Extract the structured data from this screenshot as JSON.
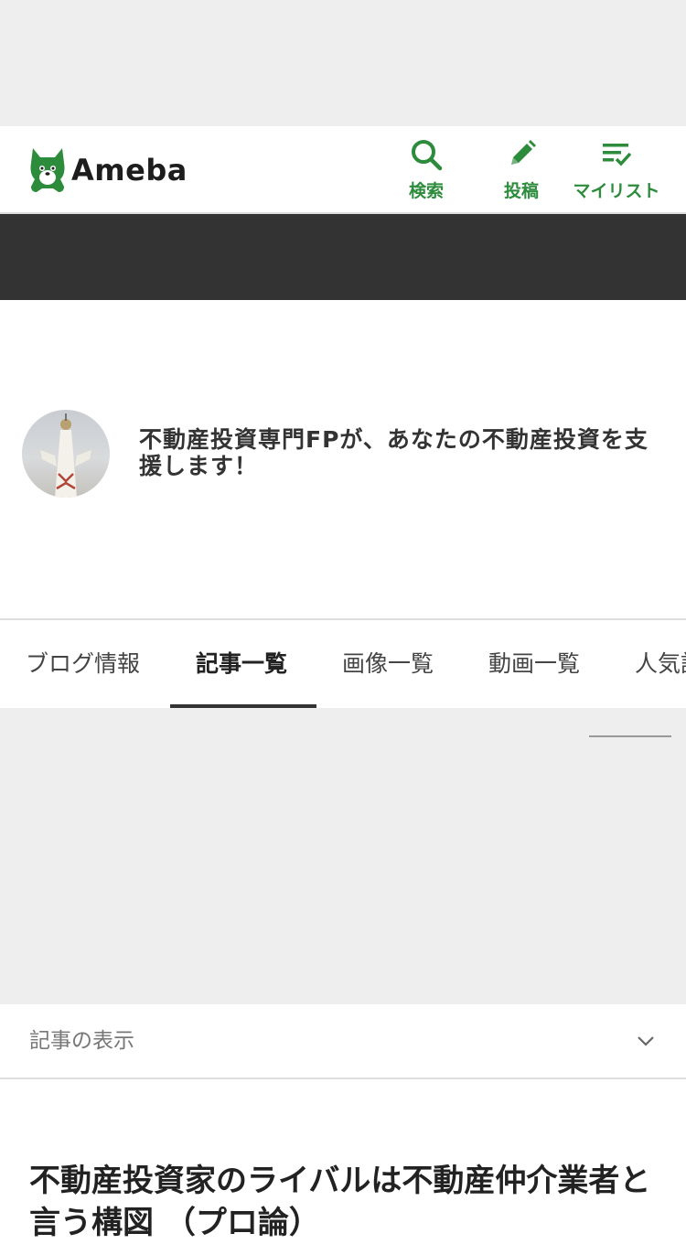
{
  "header": {
    "logo_text": "Ameba",
    "buttons": [
      {
        "label": "検索",
        "icon": "search-icon"
      },
      {
        "label": "投稿",
        "icon": "pencil-icon"
      },
      {
        "label": "マイリスト",
        "icon": "mylist-icon"
      }
    ],
    "brand_color": "#2d8c3c"
  },
  "profile": {
    "blog_title": "不動産投資専門FPが、あなたの不動産投資を支援します！"
  },
  "tabs": [
    {
      "label": "ブログ情報",
      "active": false
    },
    {
      "label": "記事一覧",
      "active": true
    },
    {
      "label": "画像一覧",
      "active": false
    },
    {
      "label": "動画一覧",
      "active": false
    },
    {
      "label": "人気記事",
      "active": false
    }
  ],
  "article_display": {
    "label": "記事の表示"
  },
  "article": {
    "title": "不動産投資家のライバルは不動産仲介業者と言う構図 （プロ論）"
  }
}
